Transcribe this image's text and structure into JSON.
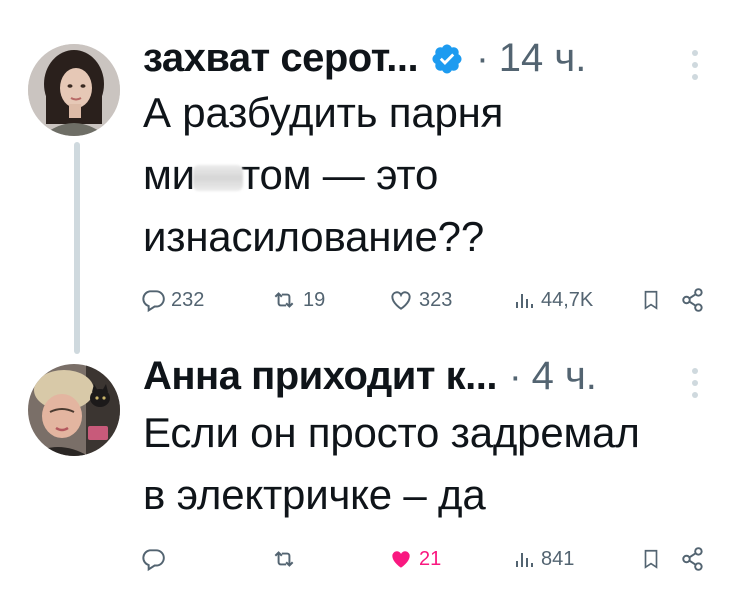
{
  "tweets": [
    {
      "author": "захват серот...",
      "verified": true,
      "separator": "·",
      "time": "14 ч.",
      "text_lines": [
        "А разбудить парня",
        "ми",
        "том — это",
        "изнасилование??"
      ],
      "metrics": {
        "replies": "232",
        "reposts": "19",
        "likes": "323",
        "views": "44,7K"
      },
      "liked": false
    },
    {
      "author": "Анна приходит к...",
      "verified": false,
      "separator": "·",
      "time": "4 ч.",
      "text_lines": [
        "Если он просто задремал",
        "в электричке – да"
      ],
      "metrics": {
        "replies": "",
        "reposts": "",
        "likes": "21",
        "views": "841"
      },
      "liked": true
    }
  ],
  "colors": {
    "accent": "#1d9bf0",
    "like": "#f91880",
    "muted": "#536471",
    "text": "#0f1419",
    "thread_line": "#cfd9de"
  },
  "icons": [
    "reply-icon",
    "repost-icon",
    "like-icon",
    "views-icon",
    "bookmark-icon",
    "share-icon",
    "more-icon",
    "verified-badge-icon"
  ]
}
